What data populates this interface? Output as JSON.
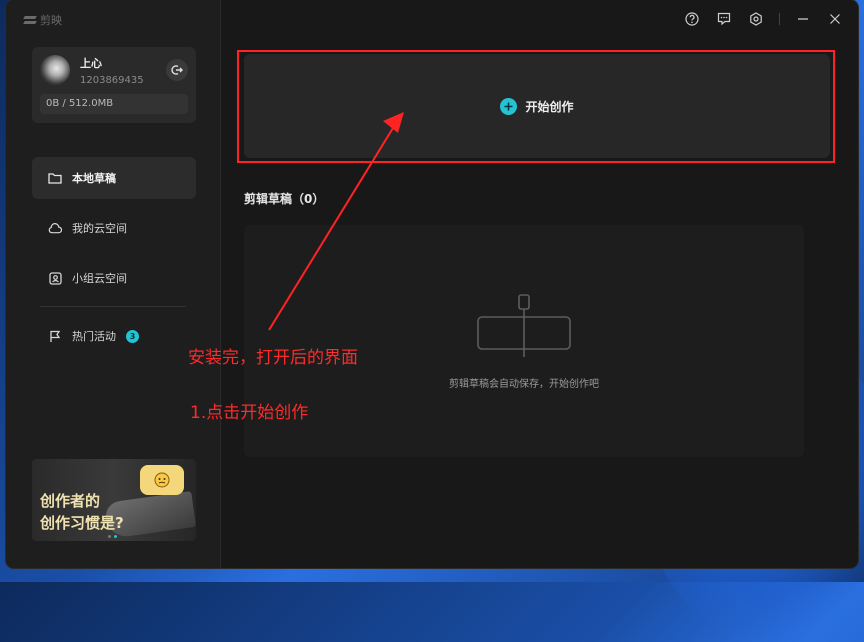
{
  "app": {
    "logo_text": "剪映"
  },
  "user": {
    "name": "上心",
    "id": "1203869435",
    "storage": "0B / 512.0MB"
  },
  "nav": {
    "items": [
      {
        "label": "本地草稿",
        "icon": "folder-icon",
        "active": true
      },
      {
        "label": "我的云空间",
        "icon": "cloud-icon",
        "active": false
      },
      {
        "label": "小组云空间",
        "icon": "team-drive-icon",
        "active": false
      }
    ],
    "hot": {
      "label": "热门活动",
      "icon": "flag-icon",
      "badge": "3"
    }
  },
  "banner": {
    "line1": "创作者的",
    "line2": "创作习惯是?"
  },
  "main": {
    "start_label": "开始创作",
    "drafts_title": "剪辑草稿（0）",
    "empty_text": "剪辑草稿会自动保存，开始创作吧"
  },
  "annotations": {
    "note1": "安装完，打开后的界面",
    "note2": "1.点击开始创作",
    "color": "#ff2323"
  },
  "colors": {
    "accent": "#22c4d4",
    "window_bg": "#181818",
    "sidebar_bg": "#1e1e1e"
  }
}
